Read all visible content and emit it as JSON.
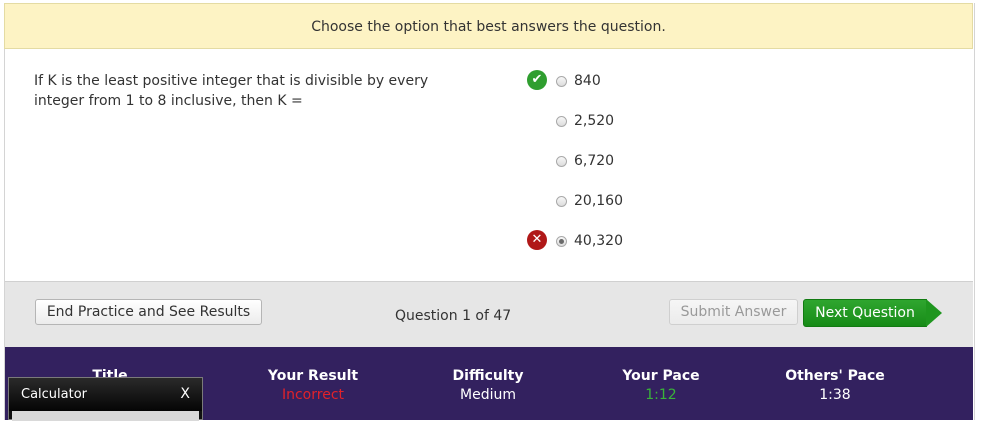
{
  "banner": {
    "text": "Choose the option that best answers the question."
  },
  "question": {
    "text": "If K is the least positive integer that is divisible by every integer from 1 to 8 inclusive, then K ="
  },
  "choices": [
    {
      "label": "840",
      "selected": false,
      "mark": "correct",
      "mark_icon": "check-icon",
      "mark_color": "#2f9e2f"
    },
    {
      "label": "2,520",
      "selected": false,
      "mark": ""
    },
    {
      "label": "6,720",
      "selected": false,
      "mark": ""
    },
    {
      "label": "20,160",
      "selected": false,
      "mark": ""
    },
    {
      "label": "40,320",
      "selected": true,
      "mark": "incorrect",
      "mark_icon": "cross-icon",
      "mark_color": "#b01818"
    }
  ],
  "footer": {
    "end_label": "End Practice and See Results",
    "question_count": "Question 1 of 47",
    "submit_label": "Submit Answer",
    "next_label": "Next Question"
  },
  "stats": {
    "title_header": "Title",
    "result_header": "Your Result",
    "result_value": "Incorrect",
    "result_color": "#e0222a",
    "difficulty_header": "Difficulty",
    "difficulty_value": "Medium",
    "pace_header": "Your Pace",
    "pace_value": "1:12",
    "pace_color": "#39b339",
    "others_header": "Others' Pace",
    "others_value": "1:38",
    "background": "#33215f"
  },
  "calculator": {
    "title": "Calculator",
    "close_label": "X"
  }
}
